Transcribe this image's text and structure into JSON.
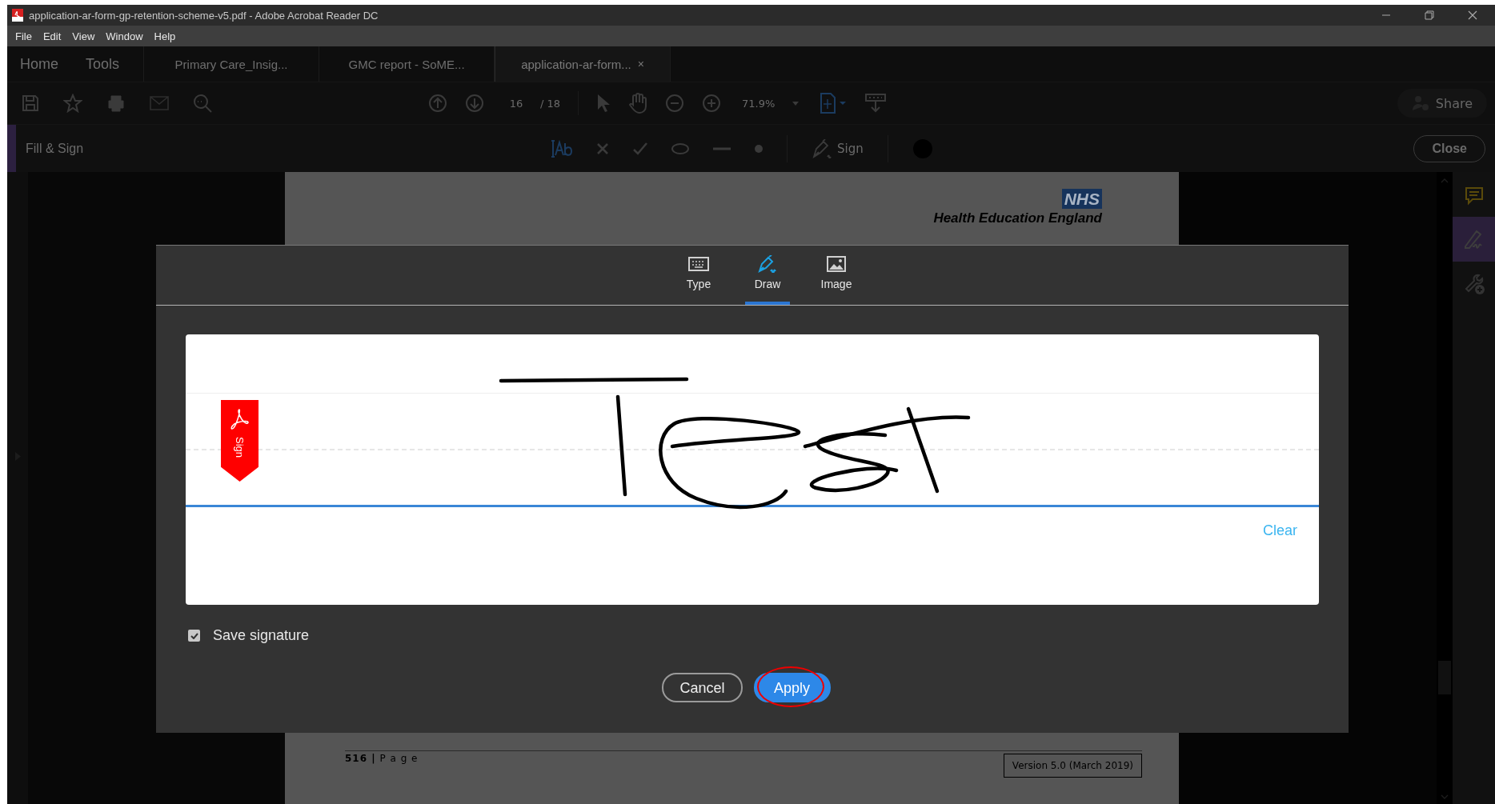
{
  "window": {
    "title": "application-ar-form-gp-retention-scheme-v5.pdf - Adobe Acrobat Reader DC"
  },
  "menu": [
    {
      "label": "File"
    },
    {
      "label": "Edit"
    },
    {
      "label": "View"
    },
    {
      "label": "Window"
    },
    {
      "label": "Help"
    }
  ],
  "tabs": [
    {
      "label": "Home",
      "kind": "nav",
      "selected": false
    },
    {
      "label": "Tools",
      "kind": "nav",
      "selected": false
    },
    {
      "label": "Primary Care_Insig...",
      "kind": "doc",
      "selected": false
    },
    {
      "label": "GMC report - SoME...",
      "kind": "doc",
      "selected": false
    },
    {
      "label": "application-ar-form...",
      "kind": "doc",
      "selected": true,
      "close": "×"
    }
  ],
  "toolbar": {
    "page": "16",
    "page_total": "/ 18",
    "zoom": "71.9%",
    "share": "Share"
  },
  "fill_sign": {
    "title": "Fill & Sign",
    "sign": "Sign",
    "close": "Close"
  },
  "document": {
    "badge": "NHS",
    "organisation": "Health Education England",
    "page_number": "**516 |** P a g e",
    "version": "Version 5.0 (March 2019)"
  },
  "dialog": {
    "tabs": [
      {
        "label": "Type",
        "kind": "keyboard",
        "selected": false
      },
      {
        "label": "Draw",
        "kind": "pen",
        "selected": true
      },
      {
        "label": "Image",
        "kind": "image",
        "selected": false
      }
    ],
    "sign_tag": "Sign",
    "clear": "Clear",
    "save_signature": {
      "label": "Save signature",
      "checked": true
    },
    "buttons": [
      {
        "label": "Cancel",
        "kind": "secondary",
        "circled": false
      },
      {
        "label": "Apply",
        "kind": "primary",
        "circled": true
      }
    ]
  }
}
